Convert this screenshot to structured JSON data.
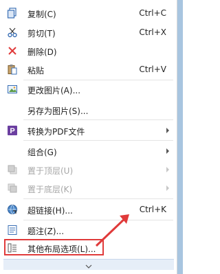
{
  "menu": {
    "items": [
      {
        "label": "复制(C)",
        "shortcut": "Ctrl+C",
        "icon": "copy-icon"
      },
      {
        "label": "剪切(T)",
        "shortcut": "Ctrl+X",
        "icon": "cut-icon"
      },
      {
        "label": "删除(D)",
        "shortcut": "",
        "icon": "delete-icon"
      },
      {
        "label": "粘贴",
        "shortcut": "Ctrl+V",
        "icon": "paste-icon"
      },
      {
        "label": "更改图片(A)...",
        "shortcut": "",
        "icon": "change-picture-icon"
      },
      {
        "label": "另存为图片(S)...",
        "shortcut": "",
        "icon": ""
      },
      {
        "label": "转换为PDF文件",
        "shortcut": "",
        "icon": "pdf-icon",
        "submenu": true
      },
      {
        "label": "组合(G)",
        "shortcut": "",
        "icon": "",
        "submenu": true
      },
      {
        "label": "置于顶层(U)",
        "shortcut": "",
        "icon": "bring-to-front-icon",
        "submenu": true,
        "disabled": true
      },
      {
        "label": "置于底层(K)",
        "shortcut": "",
        "icon": "send-to-back-icon",
        "submenu": true,
        "disabled": true
      },
      {
        "label": "超链接(H)...",
        "shortcut": "Ctrl+K",
        "icon": "hyperlink-icon"
      },
      {
        "label": "题注(Z)...",
        "shortcut": "",
        "icon": "caption-icon"
      },
      {
        "label": "其他布局选项(L)...",
        "shortcut": "",
        "icon": "layout-options-icon"
      }
    ]
  },
  "colors": {
    "highlight": "#e03a3a",
    "delete": "#e03a3a",
    "pdf": "#6b3fa0"
  }
}
